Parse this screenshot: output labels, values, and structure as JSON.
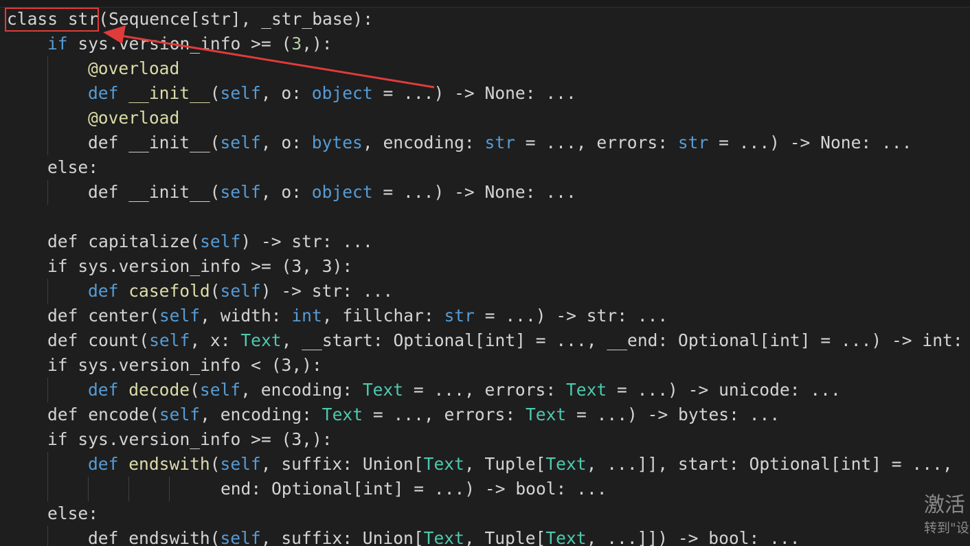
{
  "code_lines": [
    {
      "indent": 0,
      "guides": [],
      "tokens": [
        {
          "t": "class str",
          "c": ""
        },
        {
          "t": "(Sequence[str], _str_base):",
          "c": ""
        }
      ]
    },
    {
      "indent": 1,
      "guides": [
        0
      ],
      "tokens": [
        {
          "t": "if",
          "c": "kw"
        },
        {
          "t": " sys.version_info >= (",
          "c": ""
        },
        {
          "t": "3",
          "c": "nu"
        },
        {
          "t": ",):",
          "c": ""
        }
      ]
    },
    {
      "indent": 2,
      "guides": [
        0,
        1
      ],
      "tokens": [
        {
          "t": "@overload",
          "c": "dc"
        }
      ]
    },
    {
      "indent": 2,
      "guides": [
        0,
        1
      ],
      "tokens": [
        {
          "t": "def",
          "c": "kw"
        },
        {
          "t": " ",
          "c": ""
        },
        {
          "t": "__init__",
          "c": "fn"
        },
        {
          "t": "(",
          "c": ""
        },
        {
          "t": "self",
          "c": "kw"
        },
        {
          "t": ", o: ",
          "c": ""
        },
        {
          "t": "object",
          "c": "kw"
        },
        {
          "t": " = ...) -> None: ...",
          "c": ""
        }
      ]
    },
    {
      "indent": 2,
      "guides": [
        0,
        1
      ],
      "tokens": [
        {
          "t": "@overload",
          "c": "dc"
        }
      ]
    },
    {
      "indent": 2,
      "guides": [
        0,
        1
      ],
      "tokens": [
        {
          "t": "def __init__(",
          "c": ""
        },
        {
          "t": "self",
          "c": "kw"
        },
        {
          "t": ", o: ",
          "c": ""
        },
        {
          "t": "bytes",
          "c": "kw"
        },
        {
          "t": ", encoding: ",
          "c": ""
        },
        {
          "t": "str",
          "c": "kw"
        },
        {
          "t": " = ..., errors: ",
          "c": ""
        },
        {
          "t": "str",
          "c": "kw"
        },
        {
          "t": " = ...) -> None: ...",
          "c": ""
        }
      ]
    },
    {
      "indent": 1,
      "guides": [
        0
      ],
      "tokens": [
        {
          "t": "else:",
          "c": ""
        }
      ]
    },
    {
      "indent": 2,
      "guides": [
        0,
        1
      ],
      "tokens": [
        {
          "t": "def __init__(",
          "c": ""
        },
        {
          "t": "self",
          "c": "kw"
        },
        {
          "t": ", o: ",
          "c": ""
        },
        {
          "t": "object",
          "c": "kw"
        },
        {
          "t": " = ...) -> None: ...",
          "c": ""
        }
      ]
    },
    {
      "indent": 0,
      "guides": [
        0
      ],
      "tokens": []
    },
    {
      "indent": 1,
      "guides": [
        0
      ],
      "tokens": [
        {
          "t": "def capitalize(",
          "c": ""
        },
        {
          "t": "self",
          "c": "kw"
        },
        {
          "t": ") -> str: ...",
          "c": ""
        }
      ]
    },
    {
      "indent": 1,
      "guides": [
        0
      ],
      "tokens": [
        {
          "t": "if sys.version_info >= (3, 3):",
          "c": ""
        }
      ]
    },
    {
      "indent": 2,
      "guides": [
        0,
        1
      ],
      "tokens": [
        {
          "t": "def",
          "c": "kw"
        },
        {
          "t": " ",
          "c": ""
        },
        {
          "t": "casefold",
          "c": "fn"
        },
        {
          "t": "(",
          "c": ""
        },
        {
          "t": "self",
          "c": "kw"
        },
        {
          "t": ") -> str: ...",
          "c": ""
        }
      ]
    },
    {
      "indent": 1,
      "guides": [
        0
      ],
      "tokens": [
        {
          "t": "def center(",
          "c": ""
        },
        {
          "t": "self",
          "c": "kw"
        },
        {
          "t": ", width: ",
          "c": ""
        },
        {
          "t": "int",
          "c": "kw"
        },
        {
          "t": ", fillchar: ",
          "c": ""
        },
        {
          "t": "str",
          "c": "kw"
        },
        {
          "t": " = ...) -> str: ...",
          "c": ""
        }
      ]
    },
    {
      "indent": 1,
      "guides": [
        0
      ],
      "tokens": [
        {
          "t": "def count(",
          "c": ""
        },
        {
          "t": "self",
          "c": "kw"
        },
        {
          "t": ", x: ",
          "c": ""
        },
        {
          "t": "Text",
          "c": "ty"
        },
        {
          "t": ", __start: Optional[int] = ..., __end: Optional[int] = ...) -> int: ...",
          "c": ""
        }
      ]
    },
    {
      "indent": 1,
      "guides": [
        0
      ],
      "tokens": [
        {
          "t": "if sys.version_info < (3,):",
          "c": ""
        }
      ]
    },
    {
      "indent": 2,
      "guides": [
        0,
        1
      ],
      "tokens": [
        {
          "t": "def",
          "c": "kw"
        },
        {
          "t": " ",
          "c": ""
        },
        {
          "t": "decode",
          "c": "fn"
        },
        {
          "t": "(",
          "c": ""
        },
        {
          "t": "self",
          "c": "kw"
        },
        {
          "t": ", encoding: ",
          "c": ""
        },
        {
          "t": "Text",
          "c": "ty"
        },
        {
          "t": " = ..., errors: ",
          "c": ""
        },
        {
          "t": "Text",
          "c": "ty"
        },
        {
          "t": " = ...) -> unicode: ...",
          "c": ""
        }
      ]
    },
    {
      "indent": 1,
      "guides": [
        0
      ],
      "tokens": [
        {
          "t": "def encode(",
          "c": ""
        },
        {
          "t": "self",
          "c": "kw"
        },
        {
          "t": ", encoding: ",
          "c": ""
        },
        {
          "t": "Text",
          "c": "ty"
        },
        {
          "t": " = ..., errors: ",
          "c": ""
        },
        {
          "t": "Text",
          "c": "ty"
        },
        {
          "t": " = ...) -> bytes: ...",
          "c": ""
        }
      ]
    },
    {
      "indent": 1,
      "guides": [
        0
      ],
      "tokens": [
        {
          "t": "if sys.version_info >= (3,):",
          "c": ""
        }
      ]
    },
    {
      "indent": 2,
      "guides": [
        0,
        1
      ],
      "tokens": [
        {
          "t": "def",
          "c": "kw"
        },
        {
          "t": " ",
          "c": ""
        },
        {
          "t": "endswith",
          "c": "fn"
        },
        {
          "t": "(",
          "c": ""
        },
        {
          "t": "self",
          "c": "kw"
        },
        {
          "t": ", suffix: Union[",
          "c": ""
        },
        {
          "t": "Text",
          "c": "ty"
        },
        {
          "t": ", Tuple[",
          "c": ""
        },
        {
          "t": "Text",
          "c": "ty"
        },
        {
          "t": ", ...]], start: Optional[int] = ...,",
          "c": ""
        }
      ]
    },
    {
      "indent": 0,
      "guides": [
        0,
        1,
        2,
        3,
        4
      ],
      "tokens": [
        {
          "t": "                     end: Optional[int] = ...) -> bool: ...",
          "c": ""
        }
      ]
    },
    {
      "indent": 1,
      "guides": [
        0
      ],
      "tokens": [
        {
          "t": "else:",
          "c": ""
        }
      ]
    },
    {
      "indent": 2,
      "guides": [
        0,
        1
      ],
      "tokens": [
        {
          "t": "def endswith(",
          "c": ""
        },
        {
          "t": "self",
          "c": "kw"
        },
        {
          "t": ", suffix: Union[",
          "c": ""
        },
        {
          "t": "Text",
          "c": "ty"
        },
        {
          "t": ", Tuple[",
          "c": ""
        },
        {
          "t": "Text",
          "c": "ty"
        },
        {
          "t": ", ...]]) -> bool: ...",
          "c": ""
        }
      ]
    }
  ],
  "annotation": {
    "box_label": "class str",
    "color": "#e03b3b"
  },
  "watermark": {
    "title": "激活",
    "subtitle": "转到\"设"
  },
  "colors": {
    "background": "#1e1e1e",
    "text": "#d4d4d4",
    "keyword": "#569cd6",
    "function": "#dcdcaa",
    "type": "#4ec9b0",
    "number": "#b5cea8"
  }
}
